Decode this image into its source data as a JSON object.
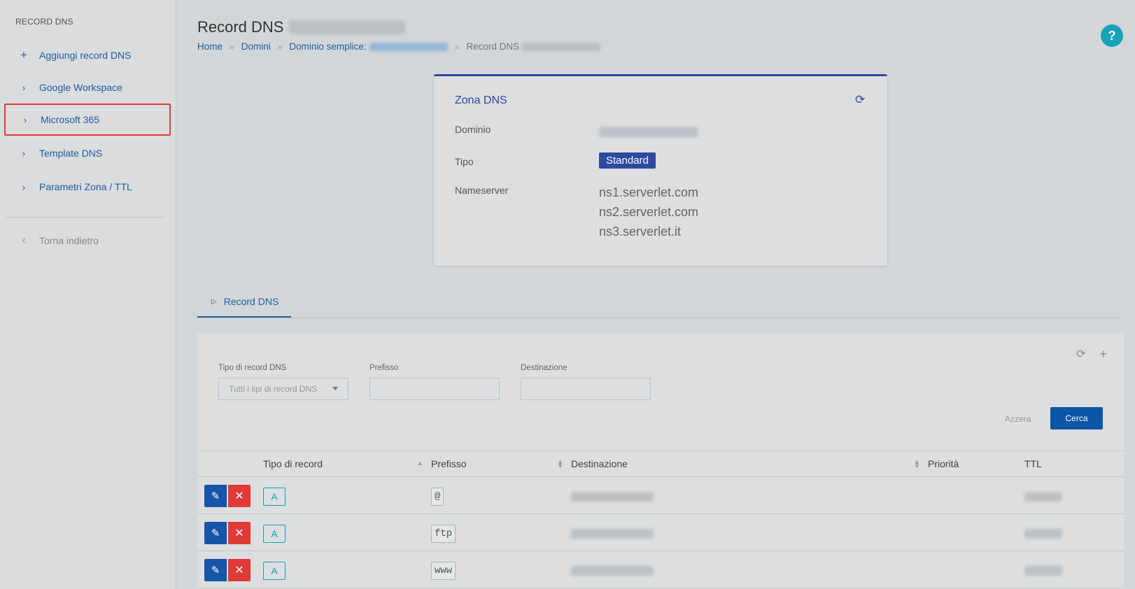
{
  "sidebar": {
    "title": "RECORD DNS",
    "items": [
      {
        "label": "Aggiungi record DNS",
        "icon": "plus-icon"
      },
      {
        "label": "Google Workspace",
        "icon": "chevron-right-icon"
      },
      {
        "label": "Microsoft 365",
        "icon": "chevron-right-icon"
      },
      {
        "label": "Template DNS",
        "icon": "chevron-right-icon"
      },
      {
        "label": "Parametri Zona / TTL",
        "icon": "chevron-right-icon"
      }
    ],
    "back_label": "Torna indietro"
  },
  "header": {
    "title": "Record DNS",
    "breadcrumb": {
      "home": "Home",
      "domains": "Domini",
      "simple_domain": "Dominio semplice:",
      "current": "Record DNS"
    },
    "help_label": "?"
  },
  "zone": {
    "title": "Zona DNS",
    "domain_label": "Dominio",
    "type_label": "Tipo",
    "type_value": "Standard",
    "nameserver_label": "Nameserver",
    "nameservers": [
      "ns1.serverlet.com",
      "ns2.serverlet.com",
      "ns3.serverlet.it"
    ]
  },
  "tabs": [
    {
      "label": "Record DNS"
    }
  ],
  "filters": {
    "type_label": "Tipo di record DNS",
    "type_value": "Tutti i tipi di record DNS",
    "prefix_label": "Prefisso",
    "destination_label": "Destinazione",
    "reset_label": "Azzera",
    "search_label": "Cerca"
  },
  "table": {
    "columns": [
      "Tipo di record",
      "Prefisso",
      "Destinazione",
      "Priorità",
      "TTL"
    ],
    "rows": [
      {
        "type": "A",
        "prefix": "@"
      },
      {
        "type": "A",
        "prefix": "ftp"
      },
      {
        "type": "A",
        "prefix": "www"
      }
    ]
  },
  "colors": {
    "accent": "#2e4aa0",
    "link": "#1f5fa0",
    "primary_button": "#0d56a6",
    "danger": "#e03a3a",
    "info": "#17a2b8",
    "highlight_border": "#e53935"
  }
}
